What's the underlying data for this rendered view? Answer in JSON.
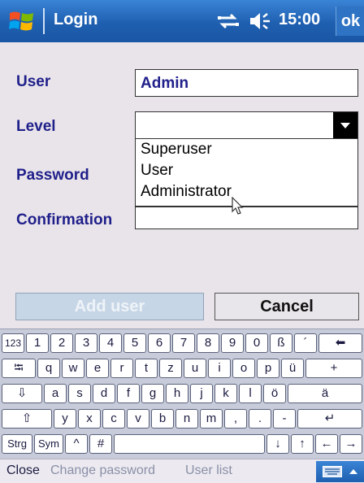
{
  "titlebar": {
    "icon": "windows-flag-icon",
    "title": "Login",
    "time": "15:00",
    "ok_label": "ok"
  },
  "form": {
    "user_label": "User",
    "user_value": "Admin",
    "level_label": "Level",
    "level_value": "",
    "level_options": [
      "Superuser",
      "User",
      "Administrator"
    ],
    "password_label": "Password",
    "confirmation_label": "Confirmation",
    "add_user_label": "Add user",
    "cancel_label": "Cancel"
  },
  "keyboard": {
    "row1": [
      "123",
      "1",
      "2",
      "3",
      "4",
      "5",
      "6",
      "7",
      "8",
      "9",
      "0",
      "ß",
      "´",
      "⬅"
    ],
    "row2": [
      "⭾",
      "q",
      "w",
      "e",
      "r",
      "t",
      "z",
      "u",
      "i",
      "o",
      "p",
      "ü",
      "+"
    ],
    "row3": [
      "⇩",
      "a",
      "s",
      "d",
      "f",
      "g",
      "h",
      "j",
      "k",
      "l",
      "ö",
      "ä"
    ],
    "row4": [
      "⇧",
      "y",
      "x",
      "c",
      "v",
      "b",
      "n",
      "m",
      ",",
      ".",
      "-",
      "↵"
    ],
    "row5": [
      "Strg",
      "Sym",
      "^",
      "#",
      "",
      "↓",
      "↑",
      "←",
      "→"
    ]
  },
  "menubar": {
    "close_label": "Close",
    "change_password_label": "Change password",
    "user_list_label": "User list"
  },
  "colors": {
    "titlebar": "#1f5fb0",
    "label_text": "#1f1f8a",
    "form_bg": "#e9e4ea",
    "keyboard_bg": "#c8ccda"
  }
}
